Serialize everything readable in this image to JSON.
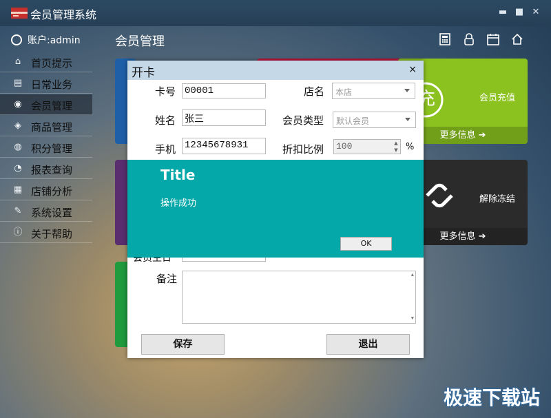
{
  "app": {
    "title": "会员管理系统"
  },
  "window_controls": {
    "minimize": "▬",
    "maximize": "■",
    "close": "✕"
  },
  "sidebar": {
    "account": "账户:admin",
    "items": [
      {
        "label": "首页提示",
        "icon": "home-icon",
        "glyph": "⌂"
      },
      {
        "label": "日常业务",
        "icon": "clipboard-icon",
        "glyph": "▤"
      },
      {
        "label": "会员管理",
        "icon": "user-icon",
        "glyph": "◉",
        "active": true
      },
      {
        "label": "商品管理",
        "icon": "box-icon",
        "glyph": "◈"
      },
      {
        "label": "积分管理",
        "icon": "points-icon",
        "glyph": "◍"
      },
      {
        "label": "报表查询",
        "icon": "report-icon",
        "glyph": "◔"
      },
      {
        "label": "店铺分析",
        "icon": "analysis-icon",
        "glyph": "▦"
      },
      {
        "label": "系统设置",
        "icon": "wrench-icon",
        "glyph": "✎"
      },
      {
        "label": "关于帮助",
        "icon": "info-icon",
        "glyph": "ⓘ"
      }
    ]
  },
  "main": {
    "title": "会员管理",
    "top_icons": [
      "calculator-icon",
      "lock-icon",
      "calendar-icon",
      "home-icon"
    ],
    "tiles": {
      "recharge": {
        "label": "会员充值",
        "more": "更多信息",
        "glyph": "充"
      },
      "unfreeze": {
        "label": "解除冻结",
        "more": "更多信息"
      }
    }
  },
  "dialog": {
    "title": "开卡",
    "close": "×",
    "card_no_label": "卡号",
    "card_no_value": "00001",
    "store_label": "店名",
    "store_value": "本店",
    "name_label": "姓名",
    "name_value": "张三",
    "member_type_label": "会员类型",
    "member_type_value": "默认会员",
    "phone_label": "手机",
    "phone_value": "12345678931",
    "discount_label": "折扣比例",
    "discount_value": "100",
    "discount_unit": "%",
    "partial_label": "会员生日",
    "remark_label": "备注",
    "save_label": "保存",
    "exit_label": "退出"
  },
  "messagebox": {
    "title": "Title",
    "message": "操作成功",
    "ok_label": "OK"
  },
  "watermark": "极速下载站",
  "colors": {
    "blue_tile": "#1f5fa8",
    "red_tile": "#c0163f",
    "green_tile": "#8cc21f",
    "dark_tile": "#2b2b2b",
    "purple_tile": "#5a2d6e",
    "green2_tile": "#1f9a3c",
    "overlay": "#05a8a8"
  }
}
